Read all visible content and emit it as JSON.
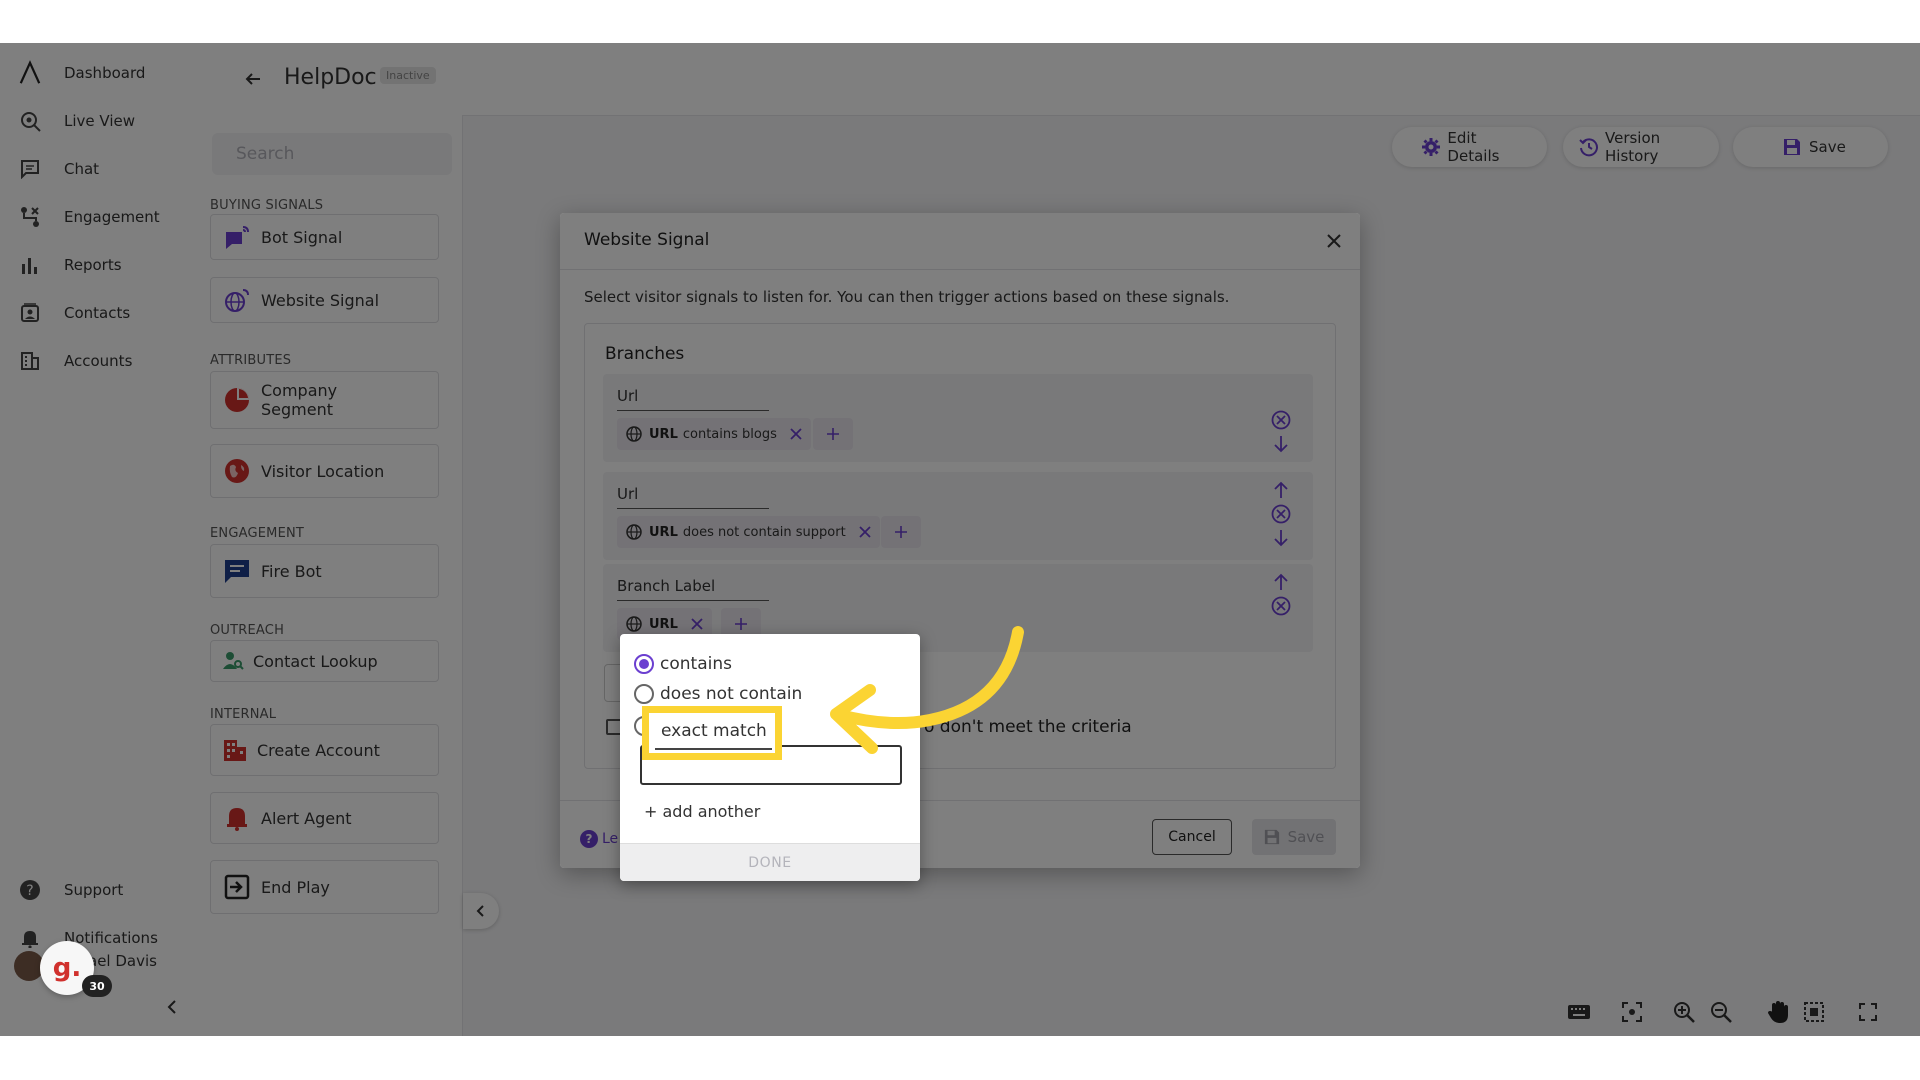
{
  "nav": {
    "items": [
      {
        "label": "Dashboard",
        "icon": "logo-icon"
      },
      {
        "label": "Live View",
        "icon": "live-view-icon"
      },
      {
        "label": "Chat",
        "icon": "chat-icon"
      },
      {
        "label": "Engagement",
        "icon": "engagement-icon"
      },
      {
        "label": "Reports",
        "icon": "reports-icon"
      },
      {
        "label": "Contacts",
        "icon": "contacts-icon"
      },
      {
        "label": "Accounts",
        "icon": "accounts-icon"
      }
    ],
    "bottom": [
      {
        "label": "Support",
        "icon": "help-icon"
      },
      {
        "label": "Notifications",
        "icon": "bell-icon"
      }
    ],
    "user_name": "ael Davis",
    "badge_letter": "g.",
    "badge_count": "30"
  },
  "header": {
    "title": "HelpDoc",
    "status": "Inactive"
  },
  "library": {
    "search_placeholder": "Search",
    "sections": {
      "buying_signals": "BUYING SIGNALS",
      "attributes": "ATTRIBUTES",
      "engagement": "ENGAGEMENT",
      "outreach": "OUTREACH",
      "internal": "INTERNAL"
    },
    "cards": {
      "bot_signal": "Bot Signal",
      "website_signal": "Website Signal",
      "company_segment_1": "Company",
      "company_segment_2": "Segment",
      "visitor_location": "Visitor Location",
      "fire_bot": "Fire Bot",
      "contact_lookup": "Contact Lookup",
      "create_account": "Create Account",
      "alert_agent": "Alert Agent",
      "end_play": "End Play"
    }
  },
  "canvas": {
    "edit_details": "Edit Details",
    "version_history": "Version History",
    "save": "Save"
  },
  "modal": {
    "title": "Website Signal",
    "description": "Select visitor signals to listen for. You can then trigger actions based on these signals.",
    "branches_title": "Branches",
    "branches": [
      {
        "label": "Url",
        "chip_key": "URL",
        "chip_value": "contains blogs"
      },
      {
        "label": "Url",
        "chip_key": "URL",
        "chip_value": "does not contain support"
      },
      {
        "label": "Branch Label",
        "chip_key": "URL",
        "chip_value": ""
      }
    ],
    "checkbox_label": "o don't meet the criteria",
    "help_link": "Le",
    "cancel": "Cancel",
    "save": "Save"
  },
  "popover": {
    "options": [
      "contains",
      "does not contain",
      "exact match"
    ],
    "selected": "contains",
    "add_another": "+ add another",
    "done": "DONE"
  },
  "colors": {
    "accent": "#6b3fd0",
    "highlight": "#fbd433"
  }
}
